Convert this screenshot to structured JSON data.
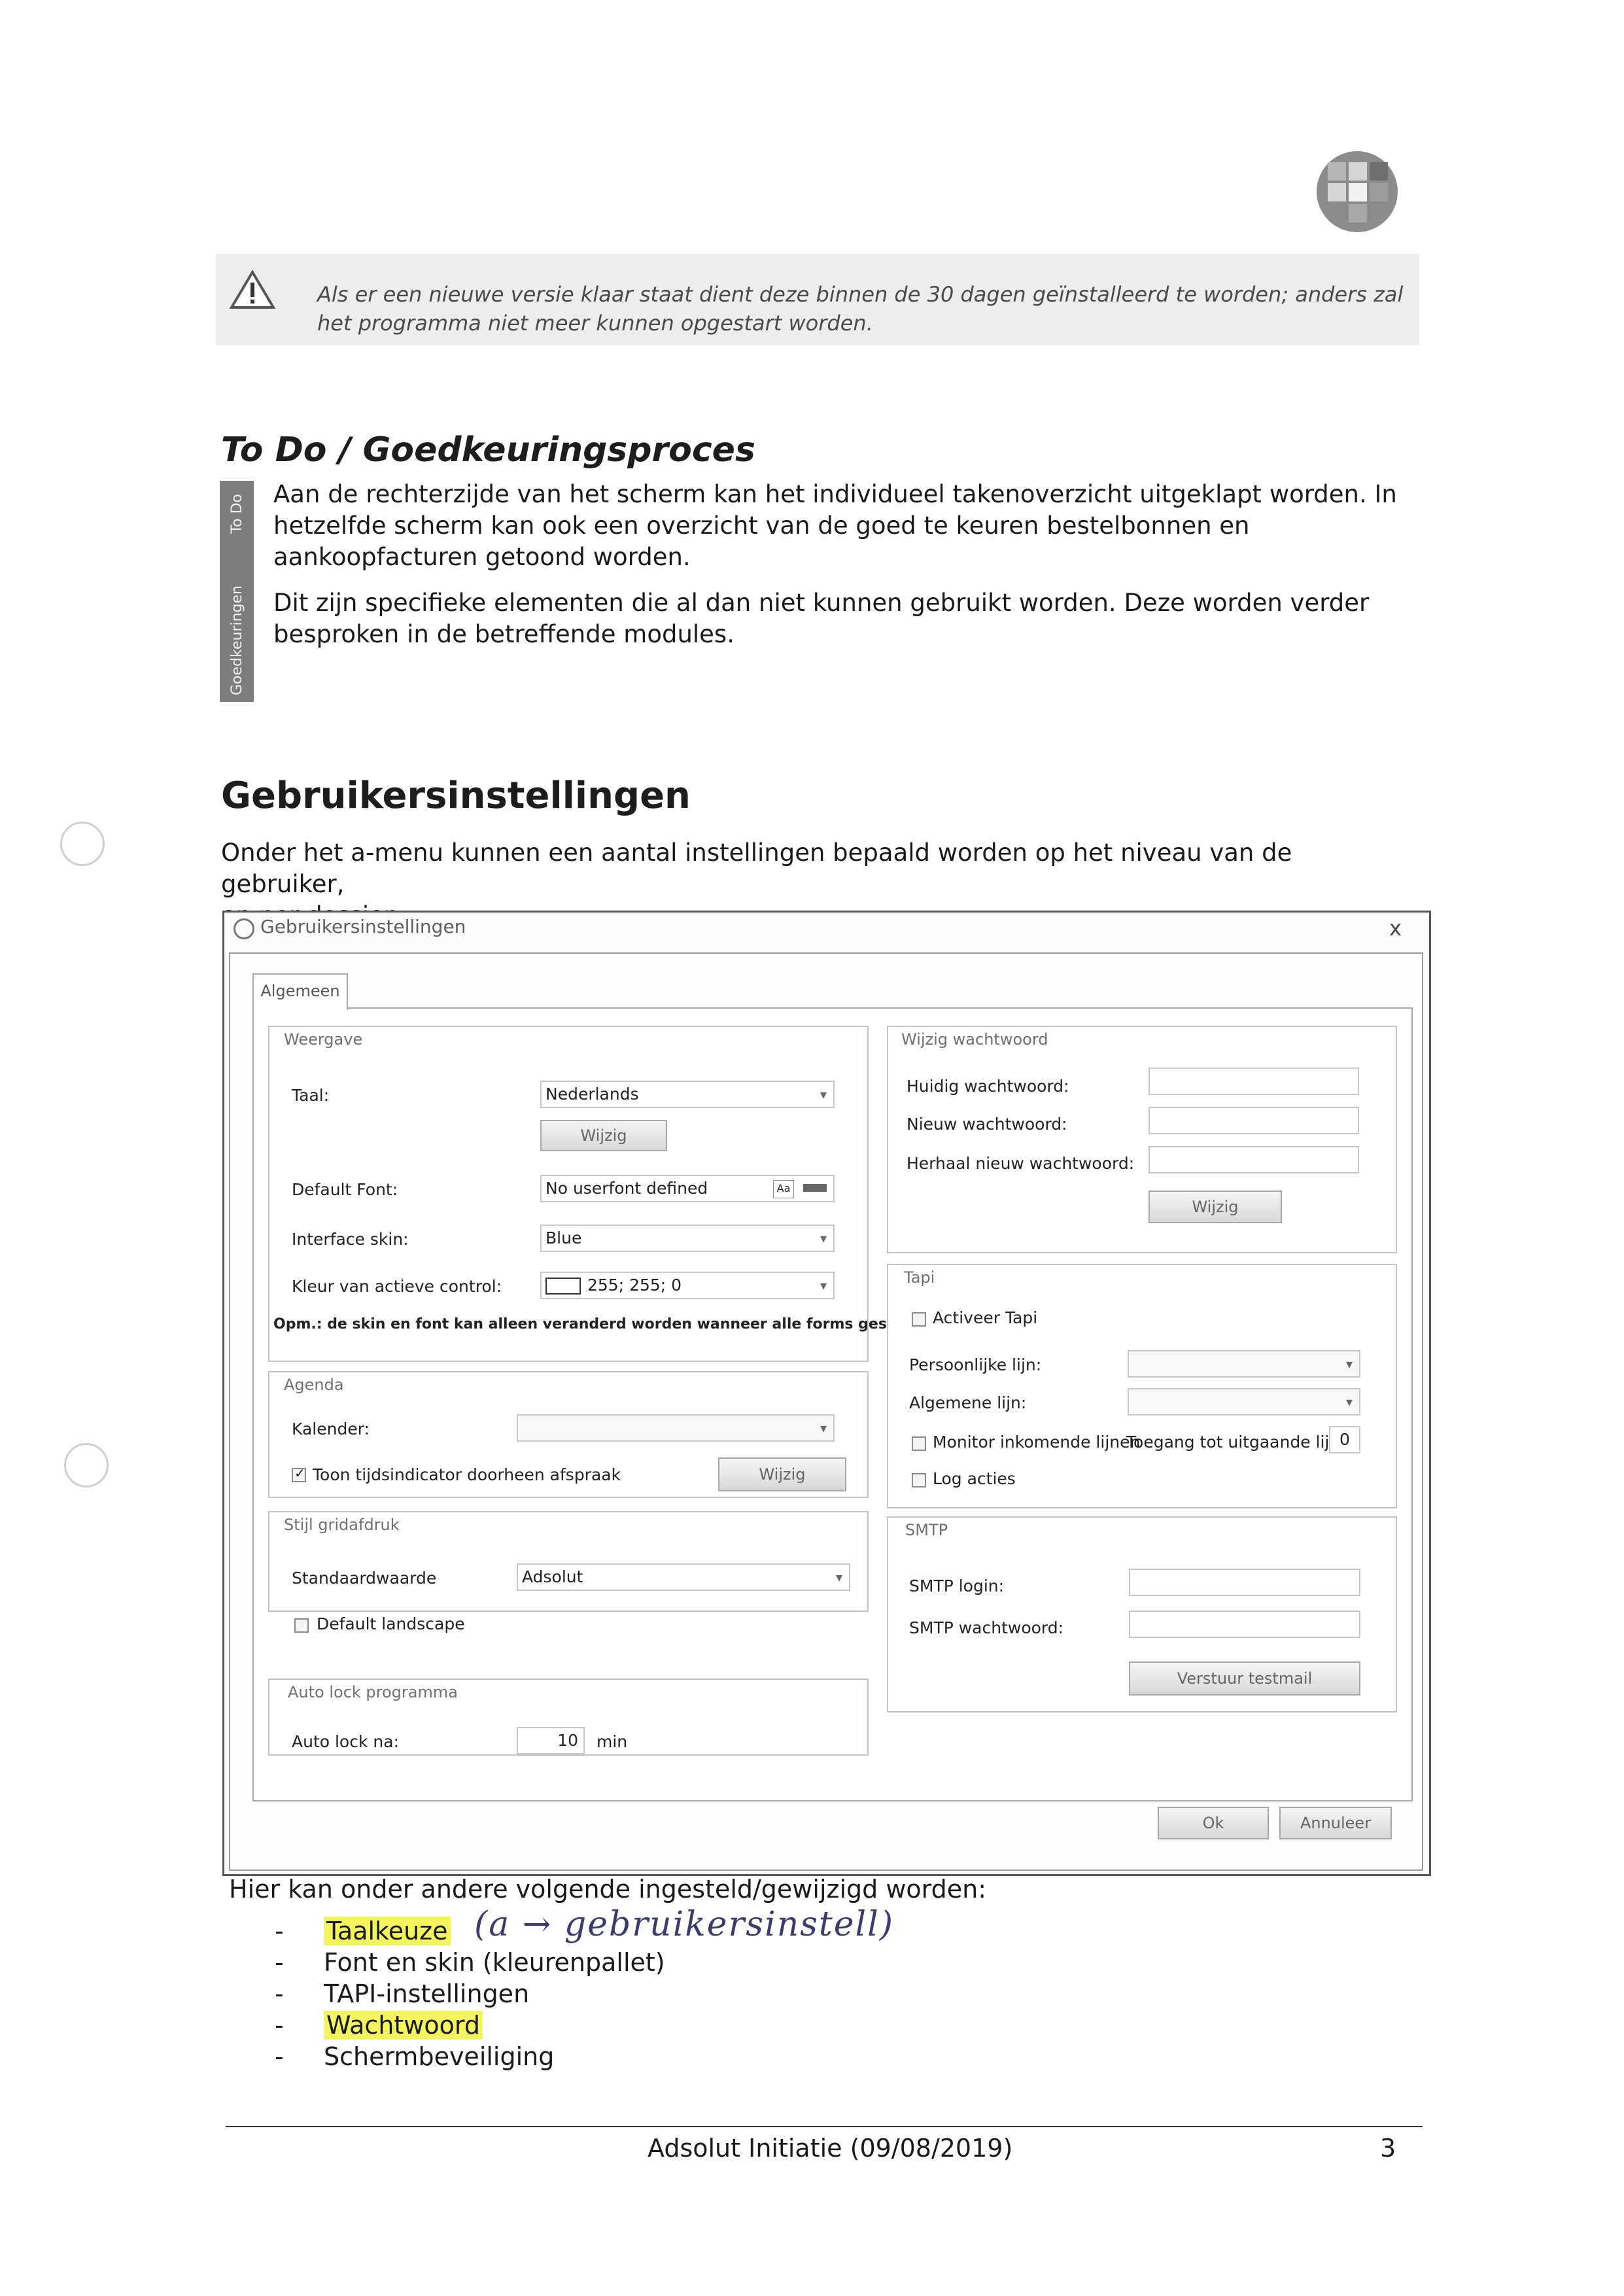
{
  "warning": {
    "text": "Als er een nieuwe versie klaar staat dient deze binnen de 30 dagen geïnstalleerd te worden; anders zal het programma niet meer kunnen opgestart worden."
  },
  "todo": {
    "heading": "To Do / Goedkeuringsproces",
    "strip_label_1": "To Do",
    "strip_label_2": "Goedkeuringen",
    "para1_line1": "Aan de rechterzijde van het scherm kan het individueel takenoverzicht uitgeklapt worden.  In",
    "para1_line2": "hetzelfde scherm kan ook een overzicht van de goed te keuren bestelbonnen en",
    "para1_line3": "aankoopfacturen getoond worden.",
    "para2_line1": "Dit zijn specifieke elementen die al dan niet kunnen gebruikt worden.  Deze worden verder",
    "para2_line2": "besproken in de betreffende modules."
  },
  "gebruikers": {
    "heading": "Gebruikersinstellingen",
    "intro_line1": "Onder het a-menu kunnen een aantal instellingen bepaald worden op het niveau van de gebruiker,",
    "intro_line2": "en per dossier."
  },
  "dialog": {
    "title": "Gebruikersinstellingen",
    "close": "x",
    "tab": "Algemeen",
    "weergave": {
      "title": "Weergave",
      "taal_label": "Taal:",
      "taal_value": "Nederlands",
      "wijzig": "Wijzig",
      "font_label": "Default Font:",
      "font_value": "No userfont defined",
      "skin_label": "Interface skin:",
      "skin_value": "Blue",
      "kleur_label": "Kleur van actieve control:",
      "kleur_value": "255; 255; 0",
      "note": "Opm.: de skin en font kan alleen veranderd worden wanneer alle forms gesloten"
    },
    "agenda": {
      "title": "Agenda",
      "kalender_label": "Kalender:",
      "toon_label": "Toon tijdsindicator doorheen afspraak",
      "wijzig": "Wijzig"
    },
    "stijl": {
      "title": "Stijl gridafdruk",
      "std_label": "Standaardwaarde",
      "std_value": "Adsolut",
      "landscape_label": "Default landscape"
    },
    "autolock": {
      "title": "Auto lock programma",
      "label": "Auto lock na:",
      "value": "10",
      "unit": "min"
    },
    "wachtwoord": {
      "title": "Wijzig wachtwoord",
      "huidig": "Huidig wachtwoord:",
      "nieuw": "Nieuw wachtwoord:",
      "herhaal": "Herhaal nieuw wachtwoord:",
      "wijzig": "Wijzig"
    },
    "tapi": {
      "title": "Tapi",
      "activeer": "Activeer Tapi",
      "persoonlijke": "Persoonlijke lijn:",
      "algemene": "Algemene lijn:",
      "monitor": "Monitor inkomende lijnen",
      "toegang": "Toegang tot uitgaande lijn",
      "toegang_value": "0",
      "log": "Log acties"
    },
    "smtp": {
      "title": "SMTP",
      "login": "SMTP login:",
      "wachtwoord": "SMTP wachtwoord:",
      "testmail": "Verstuur testmail"
    },
    "ok": "Ok",
    "annuleer": "Annuleer"
  },
  "list": {
    "intro": "Hier kan onder andere volgende ingesteld/gewijzigd worden:",
    "items": [
      "Taalkeuze",
      "Font en skin (kleurenpallet)",
      "TAPI-instellingen",
      "Wachtwoord",
      "Schermbeveiliging"
    ],
    "handwritten": "(a → gebruikersinstell)"
  },
  "footer": {
    "title": "Adsolut Initiatie (09/08/2019)",
    "page": "3"
  }
}
